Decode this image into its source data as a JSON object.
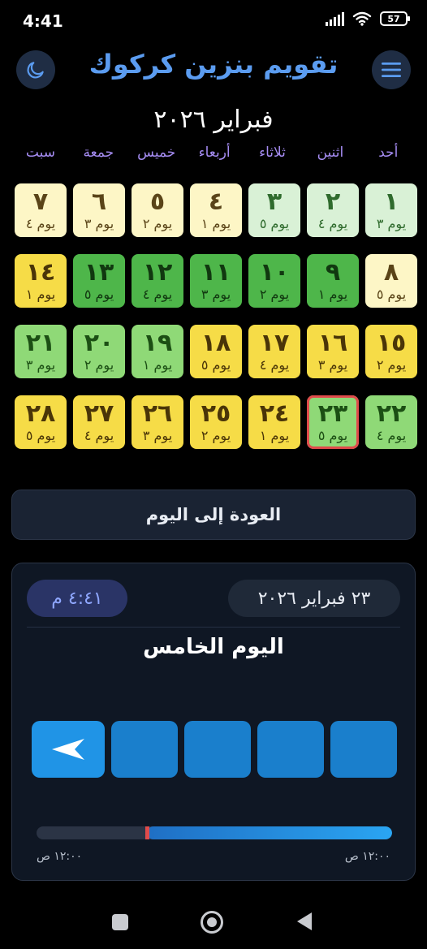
{
  "status": {
    "time": "4:41",
    "battery": "57"
  },
  "header": {
    "title": "تقويم بنزين كركوك"
  },
  "calendar": {
    "month_title": "فبراير ٢٠٢٦",
    "weekdays": [
      "أحد",
      "اثنين",
      "ثلاثاء",
      "أربعاء",
      "خميس",
      "جمعة",
      "سبت"
    ],
    "days": [
      {
        "num": "١",
        "sub": "يوم ٣",
        "color": "pale"
      },
      {
        "num": "٢",
        "sub": "يوم ٤",
        "color": "pale"
      },
      {
        "num": "٣",
        "sub": "يوم ٥",
        "color": "pale"
      },
      {
        "num": "٤",
        "sub": "يوم ١",
        "color": "cream"
      },
      {
        "num": "٥",
        "sub": "يوم ٢",
        "color": "cream"
      },
      {
        "num": "٦",
        "sub": "يوم ٣",
        "color": "cream"
      },
      {
        "num": "٧",
        "sub": "يوم ٤",
        "color": "cream"
      },
      {
        "num": "٨",
        "sub": "يوم ٥",
        "color": "cream"
      },
      {
        "num": "٩",
        "sub": "يوم ١",
        "color": "green"
      },
      {
        "num": "١٠",
        "sub": "يوم ٢",
        "color": "green"
      },
      {
        "num": "١١",
        "sub": "يوم ٣",
        "color": "green"
      },
      {
        "num": "١٢",
        "sub": "يوم ٤",
        "color": "green"
      },
      {
        "num": "١٣",
        "sub": "يوم ٥",
        "color": "green"
      },
      {
        "num": "١٤",
        "sub": "يوم ١",
        "color": "yellow"
      },
      {
        "num": "١٥",
        "sub": "يوم ٢",
        "color": "yellow"
      },
      {
        "num": "١٦",
        "sub": "يوم ٣",
        "color": "yellow"
      },
      {
        "num": "١٧",
        "sub": "يوم ٤",
        "color": "yellow"
      },
      {
        "num": "١٨",
        "sub": "يوم ٥",
        "color": "yellow"
      },
      {
        "num": "١٩",
        "sub": "يوم ١",
        "color": "light"
      },
      {
        "num": "٢٠",
        "sub": "يوم ٢",
        "color": "light"
      },
      {
        "num": "٢١",
        "sub": "يوم ٣",
        "color": "light"
      },
      {
        "num": "٢٢",
        "sub": "يوم ٤",
        "color": "light"
      },
      {
        "num": "٢٣",
        "sub": "يوم ٥",
        "color": "light",
        "today": true
      },
      {
        "num": "٢٤",
        "sub": "يوم ١",
        "color": "yellow"
      },
      {
        "num": "٢٥",
        "sub": "يوم ٢",
        "color": "yellow"
      },
      {
        "num": "٢٦",
        "sub": "يوم ٣",
        "color": "yellow"
      },
      {
        "num": "٢٧",
        "sub": "يوم ٤",
        "color": "yellow"
      },
      {
        "num": "٢٨",
        "sub": "يوم ٥",
        "color": "yellow"
      }
    ]
  },
  "back_button": {
    "label": "العودة إلى اليوم"
  },
  "card": {
    "date": "٢٣ فبراير ٢٠٢٦",
    "time": "٤:٤١ م",
    "day_label": "اليوم الخامس",
    "slots_total": 5,
    "active_slot_index": 4,
    "progress": {
      "fraction": 0.31,
      "start_label": "١٢:٠٠ ص",
      "end_label": "١٢:٠٠ ص"
    }
  },
  "colors": {
    "accent": "#5b9cf0",
    "today_outline": "#e04b4b",
    "weekday": "#a58cf2"
  },
  "icons": {
    "moon": "moon-icon",
    "menu": "hamburger-menu-icon",
    "send": "send-arrow-icon"
  }
}
